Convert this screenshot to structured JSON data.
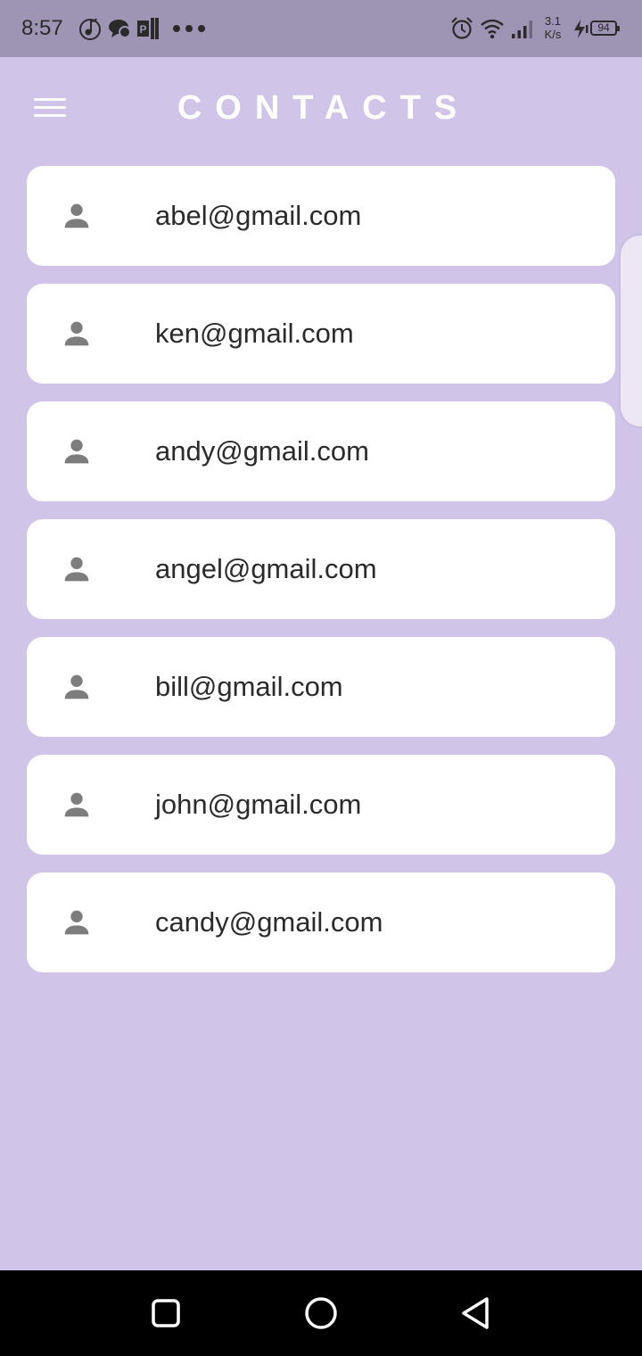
{
  "status_bar": {
    "time": "8:57",
    "speed_value": "3.1",
    "speed_unit": "K/s",
    "battery": "94",
    "icons": [
      "music-icon",
      "chat-icon",
      "publisher-icon",
      "more-dots-icon",
      "alarm-icon",
      "wifi-icon",
      "signal-icon",
      "charging-icon"
    ]
  },
  "app_bar": {
    "title": "CONTACTS",
    "menu_icon": "menu-icon"
  },
  "contacts": [
    {
      "email": "abel@gmail.com",
      "icon": "person-icon"
    },
    {
      "email": "ken@gmail.com",
      "icon": "person-icon"
    },
    {
      "email": "andy@gmail.com",
      "icon": "person-icon"
    },
    {
      "email": "angel@gmail.com",
      "icon": "person-icon"
    },
    {
      "email": "bill@gmail.com",
      "icon": "person-icon"
    },
    {
      "email": "john@gmail.com",
      "icon": "person-icon"
    },
    {
      "email": "candy@gmail.com",
      "icon": "person-icon"
    }
  ],
  "nav_bar": {
    "buttons": [
      "recents-icon",
      "home-icon",
      "back-icon"
    ]
  },
  "colors": {
    "background": "#d1c4e9",
    "status_bar": "#9e94b3",
    "card": "#ffffff",
    "title": "#ffffff",
    "person_icon": "#7d7d7d",
    "nav_bar": "#000000"
  }
}
